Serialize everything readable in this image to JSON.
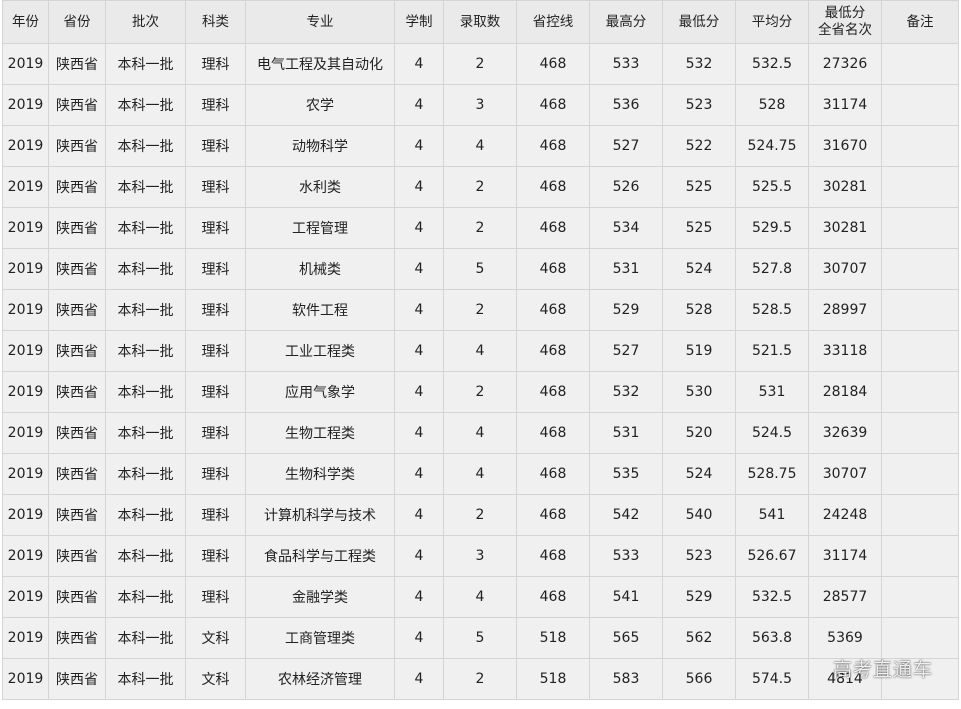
{
  "table": {
    "headers": {
      "year": "年份",
      "province": "省份",
      "batch": "批次",
      "category": "科类",
      "major": "专业",
      "duration": "学制",
      "enrolled": "录取数",
      "control_line": "省控线",
      "max_score": "最高分",
      "min_score": "最低分",
      "avg_score": "平均分",
      "min_rank_line1": "最低分",
      "min_rank_line2": "全省名次",
      "notes": "备注"
    },
    "rows": [
      {
        "year": "2019",
        "province": "陕西省",
        "batch": "本科一批",
        "category": "理科",
        "major": "电气工程及其自动化",
        "duration": "4",
        "enrolled": "2",
        "control_line": "468",
        "max_score": "533",
        "min_score": "532",
        "avg_score": "532.5",
        "min_rank": "27326",
        "notes": ""
      },
      {
        "year": "2019",
        "province": "陕西省",
        "batch": "本科一批",
        "category": "理科",
        "major": "农学",
        "duration": "4",
        "enrolled": "3",
        "control_line": "468",
        "max_score": "536",
        "min_score": "523",
        "avg_score": "528",
        "min_rank": "31174",
        "notes": ""
      },
      {
        "year": "2019",
        "province": "陕西省",
        "batch": "本科一批",
        "category": "理科",
        "major": "动物科学",
        "duration": "4",
        "enrolled": "4",
        "control_line": "468",
        "max_score": "527",
        "min_score": "522",
        "avg_score": "524.75",
        "min_rank": "31670",
        "notes": ""
      },
      {
        "year": "2019",
        "province": "陕西省",
        "batch": "本科一批",
        "category": "理科",
        "major": "水利类",
        "duration": "4",
        "enrolled": "2",
        "control_line": "468",
        "max_score": "526",
        "min_score": "525",
        "avg_score": "525.5",
        "min_rank": "30281",
        "notes": ""
      },
      {
        "year": "2019",
        "province": "陕西省",
        "batch": "本科一批",
        "category": "理科",
        "major": "工程管理",
        "duration": "4",
        "enrolled": "2",
        "control_line": "468",
        "max_score": "534",
        "min_score": "525",
        "avg_score": "529.5",
        "min_rank": "30281",
        "notes": ""
      },
      {
        "year": "2019",
        "province": "陕西省",
        "batch": "本科一批",
        "category": "理科",
        "major": "机械类",
        "duration": "4",
        "enrolled": "5",
        "control_line": "468",
        "max_score": "531",
        "min_score": "524",
        "avg_score": "527.8",
        "min_rank": "30707",
        "notes": ""
      },
      {
        "year": "2019",
        "province": "陕西省",
        "batch": "本科一批",
        "category": "理科",
        "major": "软件工程",
        "duration": "4",
        "enrolled": "2",
        "control_line": "468",
        "max_score": "529",
        "min_score": "528",
        "avg_score": "528.5",
        "min_rank": "28997",
        "notes": ""
      },
      {
        "year": "2019",
        "province": "陕西省",
        "batch": "本科一批",
        "category": "理科",
        "major": "工业工程类",
        "duration": "4",
        "enrolled": "4",
        "control_line": "468",
        "max_score": "527",
        "min_score": "519",
        "avg_score": "521.5",
        "min_rank": "33118",
        "notes": ""
      },
      {
        "year": "2019",
        "province": "陕西省",
        "batch": "本科一批",
        "category": "理科",
        "major": "应用气象学",
        "duration": "4",
        "enrolled": "2",
        "control_line": "468",
        "max_score": "532",
        "min_score": "530",
        "avg_score": "531",
        "min_rank": "28184",
        "notes": ""
      },
      {
        "year": "2019",
        "province": "陕西省",
        "batch": "本科一批",
        "category": "理科",
        "major": "生物工程类",
        "duration": "4",
        "enrolled": "4",
        "control_line": "468",
        "max_score": "531",
        "min_score": "520",
        "avg_score": "524.5",
        "min_rank": "32639",
        "notes": ""
      },
      {
        "year": "2019",
        "province": "陕西省",
        "batch": "本科一批",
        "category": "理科",
        "major": "生物科学类",
        "duration": "4",
        "enrolled": "4",
        "control_line": "468",
        "max_score": "535",
        "min_score": "524",
        "avg_score": "528.75",
        "min_rank": "30707",
        "notes": ""
      },
      {
        "year": "2019",
        "province": "陕西省",
        "batch": "本科一批",
        "category": "理科",
        "major": "计算机科学与技术",
        "duration": "4",
        "enrolled": "2",
        "control_line": "468",
        "max_score": "542",
        "min_score": "540",
        "avg_score": "541",
        "min_rank": "24248",
        "notes": ""
      },
      {
        "year": "2019",
        "province": "陕西省",
        "batch": "本科一批",
        "category": "理科",
        "major": "食品科学与工程类",
        "duration": "4",
        "enrolled": "3",
        "control_line": "468",
        "max_score": "533",
        "min_score": "523",
        "avg_score": "526.67",
        "min_rank": "31174",
        "notes": ""
      },
      {
        "year": "2019",
        "province": "陕西省",
        "batch": "本科一批",
        "category": "理科",
        "major": "金融学类",
        "duration": "4",
        "enrolled": "4",
        "control_line": "468",
        "max_score": "541",
        "min_score": "529",
        "avg_score": "532.5",
        "min_rank": "28577",
        "notes": ""
      },
      {
        "year": "2019",
        "province": "陕西省",
        "batch": "本科一批",
        "category": "文科",
        "major": "工商管理类",
        "duration": "4",
        "enrolled": "5",
        "control_line": "518",
        "max_score": "565",
        "min_score": "562",
        "avg_score": "563.8",
        "min_rank": "5369",
        "notes": ""
      },
      {
        "year": "2019",
        "province": "陕西省",
        "batch": "本科一批",
        "category": "文科",
        "major": "农林经济管理",
        "duration": "4",
        "enrolled": "2",
        "control_line": "518",
        "max_score": "583",
        "min_score": "566",
        "avg_score": "574.5",
        "min_rank": "4814",
        "notes": ""
      }
    ]
  },
  "watermark": {
    "text": "高考直通车"
  },
  "colors": {
    "header_bg": "#eaeaea",
    "row_bg": "#f0f0f0",
    "border": "#d4d4d4",
    "text": "#222222"
  }
}
